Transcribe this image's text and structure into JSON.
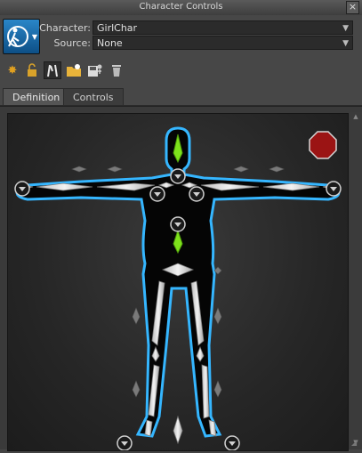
{
  "window": {
    "title": "Character Controls",
    "close_glyph": "×"
  },
  "header": {
    "app_icon": "character-controls-menu-icon",
    "character_label": "Character:",
    "character_value": "GirlChar",
    "source_label": "Source:",
    "source_value": "None"
  },
  "toolbar": {
    "tools": [
      {
        "name": "create-character-icon",
        "glyph": "✸",
        "color": "#e0a020"
      },
      {
        "name": "lock-icon",
        "glyph": "🔓",
        "color": "#d9a22a"
      },
      {
        "name": "skeleton-view-icon",
        "glyph": "⋀",
        "color": "#e8e8e8"
      },
      {
        "name": "load-file-icon",
        "glyph": "📂",
        "color": "#e8b33a"
      },
      {
        "name": "save-character-icon",
        "glyph": "💾",
        "color": "#dddddd"
      },
      {
        "name": "delete-icon",
        "glyph": "🗑",
        "color": "#cccccc"
      }
    ]
  },
  "tabs": [
    {
      "label": "Definition",
      "active": true
    },
    {
      "label": "Controls",
      "active": false
    }
  ],
  "colors": {
    "body_outline": "#33b5ff",
    "bone_fill": "#e6e6e6",
    "spine_green": "#7ee21b",
    "stop_red": "#9b1414"
  }
}
